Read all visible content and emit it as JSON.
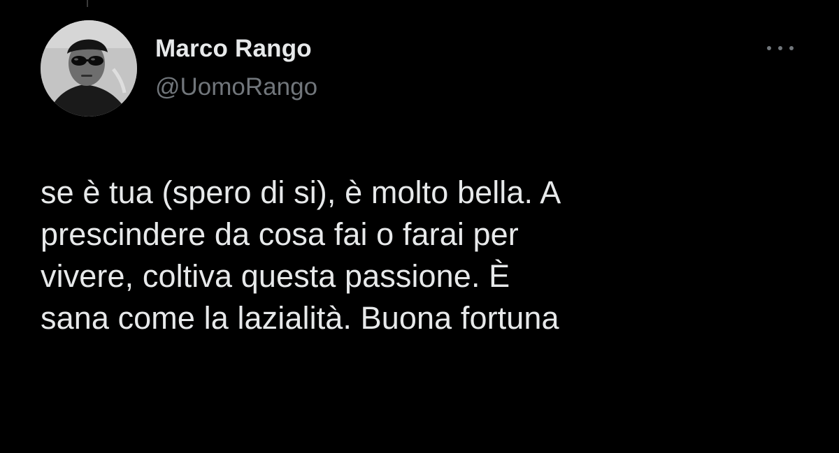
{
  "author": {
    "name": "Marco Rango",
    "handle": "@UomoRango",
    "avatar_icon": "profile-photo-sunglasses"
  },
  "more_menu": {
    "icon": "more-horizontal-icon"
  },
  "tweet": {
    "lines": [
      "se è tua (spero di si), è molto bella. A",
      "prescindere da cosa fai o farai per",
      "vivere, coltiva questa passione. È",
      "sana come la lazialità. Buona fortuna"
    ]
  },
  "colors": {
    "background": "#000000",
    "primary_text": "#e7e9ea",
    "secondary_text": "#71767b"
  }
}
